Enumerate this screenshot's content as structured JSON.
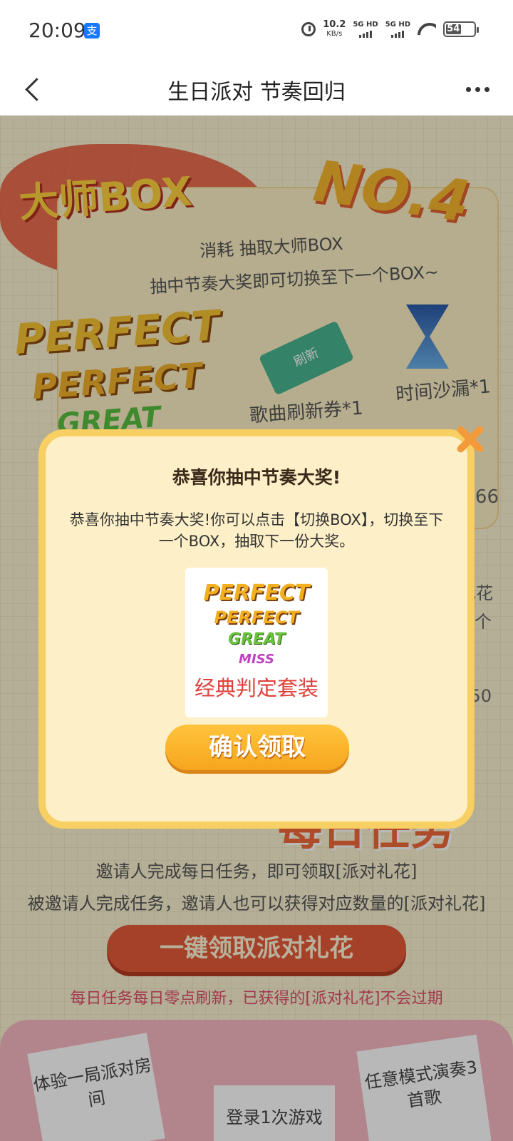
{
  "status_bar": {
    "time": "20:09",
    "alipay_badge": "支",
    "netspeed_value": "10.2",
    "netspeed_unit": "KB/s",
    "sim1": "5G HD",
    "sim2": "5G HD",
    "battery": "54"
  },
  "nav": {
    "title": "生日派对 节奏回归"
  },
  "background": {
    "box_title": "大师BOX",
    "box_number": "NO.4",
    "line1": "消耗 抽取大师BOX",
    "line2": "抽中节奏大奖即可切换至下一个BOX~",
    "perfect": "PERFECT",
    "great": "GREAT",
    "ticket_label": "刷新",
    "song_ticket": "歌曲刷新券*1",
    "hourglass": "时间沙漏*1",
    "num66": "66",
    "right_text1": "礼花",
    "right_text2": "6个",
    "right_text3": "/50",
    "task_title": "每日任务",
    "task_text1": "邀请人完成每日任务，即可领取[派对礼花]",
    "task_text2": "被邀请人完成任务，邀请人也可以获得对应数量的[派对礼花]",
    "collect_button": "一键领取派对礼花",
    "task_note": "每日任务每日零点刷新，已获得的[派对礼花]不会过期",
    "card1": "体验一局派对房间",
    "card2": "任意模式演奏3首歌",
    "card3": "登录1次游戏"
  },
  "dialog": {
    "title": "恭喜你抽中节奏大奖!",
    "message": "恭喜你抽中节奏大奖!你可以点击【切换BOX】，切换至下一个BOX，抽取下一份大奖。",
    "prize_perfect1": "PERFECT",
    "prize_perfect2": "PERFECT",
    "prize_great": "GREAT",
    "prize_miss": "MISS",
    "prize_name": "经典判定套装",
    "confirm_button": "确认领取"
  },
  "colors": {
    "accent": "#f7cf63",
    "button": "#f7a51e",
    "prize_name": "#e0403a"
  }
}
